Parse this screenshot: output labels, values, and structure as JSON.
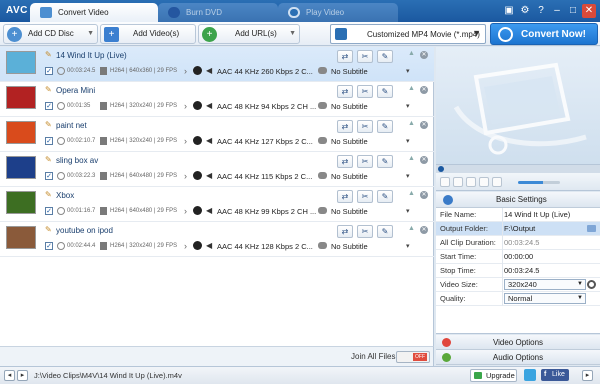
{
  "app": {
    "logo": "AVC",
    "tabs": [
      {
        "label": "Convert Video",
        "active": true
      },
      {
        "label": "Burn DVD",
        "active": false
      },
      {
        "label": "Play Video",
        "active": false
      }
    ]
  },
  "toolbar": {
    "add_cd": "Add CD Disc",
    "add_videos": "Add Video(s)",
    "add_urls": "Add URL(s)",
    "format": "Customized MP4 Movie (*.mp4)",
    "convert": "Convert Now!"
  },
  "files": [
    {
      "name": "14 Wind It Up (Live)",
      "duration": "00:03:24.5",
      "video": "H264 | 640x360 | 29 FPS",
      "audio": "AAC 44 KHz 260 Kbps 2 C...",
      "subtitle": "No Subtitle",
      "thumb_color": "#5bb0d8",
      "selected": true
    },
    {
      "name": "Opera Mini",
      "duration": "00:01:35",
      "video": "H264 | 320x240 | 29 FPS",
      "audio": "AAC 48 KHz 94 Kbps 2 CH ...",
      "subtitle": "No Subtitle",
      "thumb_color": "#b22222",
      "selected": false
    },
    {
      "name": "paint net",
      "duration": "00:02:10.7",
      "video": "H264 | 320x240 | 29 FPS",
      "audio": "AAC 44 KHz 127 Kbps 2 C...",
      "subtitle": "No Subtitle",
      "thumb_color": "#d94b1c",
      "selected": false
    },
    {
      "name": "sling box av",
      "duration": "00:03:22.3",
      "video": "H264 | 640x480 | 29 FPS",
      "audio": "AAC 44 KHz 115 Kbps 2 C...",
      "subtitle": "No Subtitle",
      "thumb_color": "#1d3f8a",
      "selected": false
    },
    {
      "name": "Xbox",
      "duration": "00:01:16.7",
      "video": "H264 | 640x480 | 29 FPS",
      "audio": "AAC 48 KHz 99 Kbps 2 CH ...",
      "subtitle": "No Subtitle",
      "thumb_color": "#3d6e22",
      "selected": false
    },
    {
      "name": "youtube on ipod",
      "duration": "00:02:44.4",
      "video": "H264 | 320x240 | 29 FPS",
      "audio": "AAC 44 KHz 128 Kbps 2 C...",
      "subtitle": "No Subtitle",
      "thumb_color": "#8a5a3a",
      "selected": false
    }
  ],
  "join": {
    "label": "Join All Files",
    "state": "OFF"
  },
  "settings": {
    "title": "Basic Settings",
    "rows": [
      {
        "key": "File Name:",
        "value": "14 Wind It Up (Live)"
      },
      {
        "key": "Output Folder:",
        "value": "F:\\Output"
      },
      {
        "key": "All Clip Duration:",
        "value": "00:03:24.5"
      },
      {
        "key": "Start Time:",
        "value": "00:00:00"
      },
      {
        "key": "Stop Time:",
        "value": "00:03:24.5"
      },
      {
        "key": "Video Size:",
        "value": "320x240"
      },
      {
        "key": "Quality:",
        "value": "Normal"
      }
    ]
  },
  "options": {
    "video": "Video Options",
    "audio": "Audio Options"
  },
  "status": {
    "path": "J:\\Video Clips\\M4V\\14 Wind It Up (Live).m4v",
    "upgrade": "Upgrade",
    "like": "Like"
  },
  "colors": {
    "accent": "#2a6fb4",
    "convert": "#1c74d0",
    "selected_row": "#cfe3f8"
  }
}
